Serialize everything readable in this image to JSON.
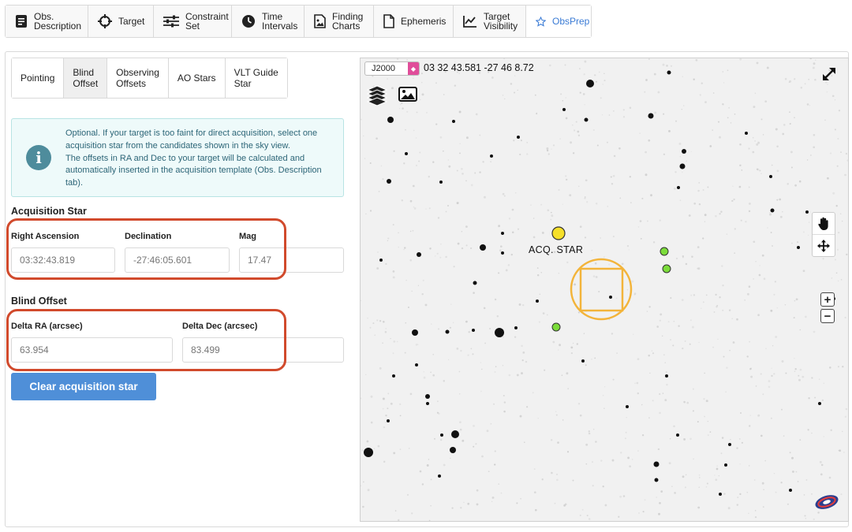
{
  "top_tabs": [
    {
      "label": "Obs.\nDescription",
      "icon": "document-list-icon"
    },
    {
      "label": "Target",
      "icon": "crosshair-icon"
    },
    {
      "label": "Constraint\nSet",
      "icon": "sliders-icon"
    },
    {
      "label": "Time\nIntervals",
      "icon": "clock-icon"
    },
    {
      "label": "Finding\nCharts",
      "icon": "image-file-icon"
    },
    {
      "label": "Ephemeris",
      "icon": "file-icon"
    },
    {
      "label": "Target\nVisibility",
      "icon": "line-chart-icon"
    },
    {
      "label": "ObsPrep",
      "icon": "star-icon",
      "active": true
    }
  ],
  "sub_tabs": [
    {
      "label": "Pointing"
    },
    {
      "label": "Blind\nOffset",
      "active": true
    },
    {
      "label": "Observing\nOffsets"
    },
    {
      "label": "AO Stars"
    },
    {
      "label": "VLT Guide\nStar"
    }
  ],
  "info": {
    "icon": "info-icon",
    "lines": [
      "Optional. If your target is too faint for direct acquisition, select one acquisition star from the candidates shown in the sky view.",
      "The offsets in RA and Dec to your target will be calculated and automatically inserted in the acquisition template (Obs. Description tab)."
    ]
  },
  "acquisition": {
    "title": "Acquisition Star",
    "ra_label": "Right Ascension",
    "ra_value": "03:32:43.819",
    "dec_label": "Declination",
    "dec_value": "-27:46:05.601",
    "mag_label": "Mag",
    "mag_value": "17.47"
  },
  "blind_offset": {
    "title": "Blind Offset",
    "dra_label": "Delta RA (arcsec)",
    "dra_value": "63.954",
    "ddec_label": "Delta Dec (arcsec)",
    "ddec_value": "83.499"
  },
  "clear_button": "Clear acquisition star",
  "sky": {
    "frame": "J2000",
    "coordinates": "03 32 43.581 -27 46 8.72",
    "acq_label": "ACQ. STAR",
    "colors": {
      "acq_star": "#f6e02a",
      "candidate": "#7bdc3a",
      "target_marker": "#f3b43a",
      "highlight": "#d14a2c",
      "accent": "#3a7bd5"
    }
  }
}
